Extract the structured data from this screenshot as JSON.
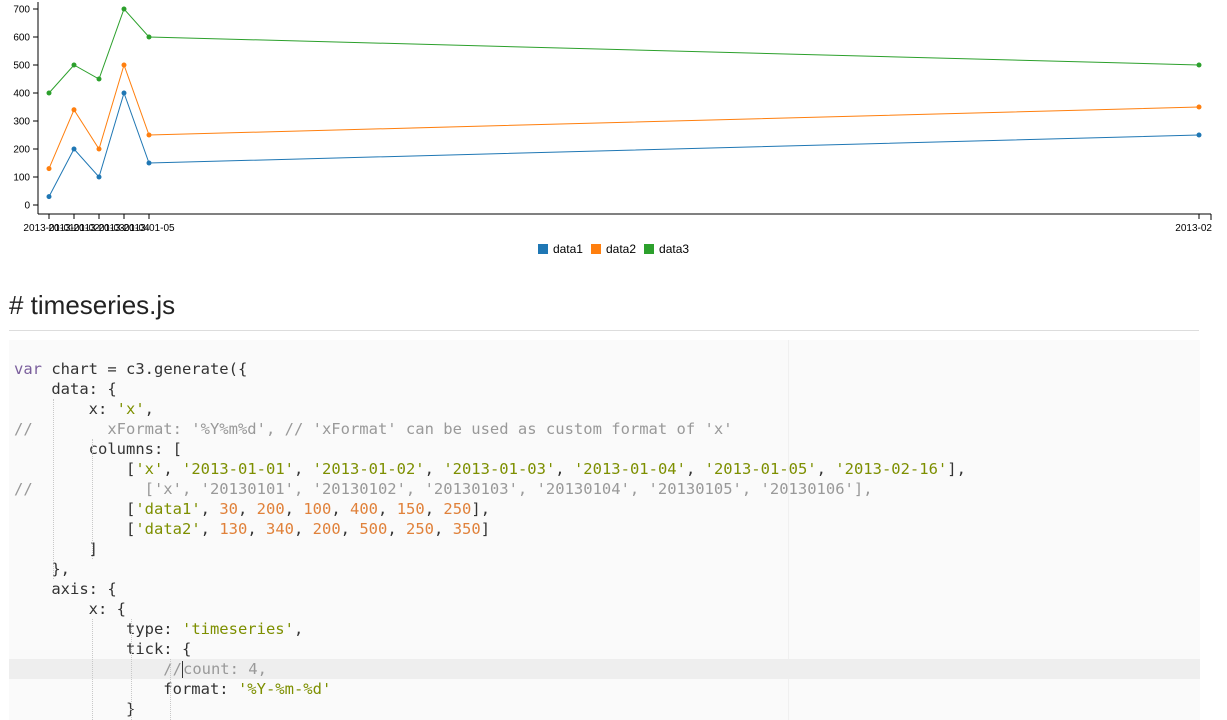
{
  "chart_data": {
    "type": "line",
    "x": [
      "2013-01-01",
      "2013-01-02",
      "2013-01-03",
      "2013-01-04",
      "2013-01-05",
      "2013-02-16"
    ],
    "tick_labels": [
      "2013-01-01",
      "2013-01-02",
      "2013-01-03",
      "2013-01-04",
      "2013-01-05",
      "2013-02"
    ],
    "series": [
      {
        "name": "data1",
        "values": [
          30,
          200,
          100,
          400,
          150,
          250
        ],
        "color": "#1f77b4"
      },
      {
        "name": "data2",
        "values": [
          130,
          340,
          200,
          500,
          250,
          350
        ],
        "color": "#ff7f0e"
      },
      {
        "name": "data3",
        "values": [
          400,
          500,
          450,
          700,
          600,
          500
        ],
        "color": "#2ca02c"
      }
    ],
    "ylim": [
      0,
      700
    ],
    "y_ticks": [
      0,
      100,
      200,
      300,
      400,
      500,
      600,
      700
    ],
    "legend_position": "bottom-center",
    "grid": false
  },
  "heading": "# timeseries.js",
  "code_lines": [
    {
      "tokens": [
        {
          "t": "var",
          "c": "kw"
        },
        {
          "t": " chart = c3.generate({",
          "c": ""
        }
      ]
    },
    {
      "tokens": [
        {
          "t": "    data: {",
          "c": ""
        }
      ]
    },
    {
      "tokens": [
        {
          "t": "        x: ",
          "c": ""
        },
        {
          "t": "'x'",
          "c": "str"
        },
        {
          "t": ",",
          "c": ""
        }
      ]
    },
    {
      "tokens": [
        {
          "t": "//        xFormat: '%Y%m%d', // 'xFormat' can be used as custom format of 'x'",
          "c": "cmt"
        }
      ]
    },
    {
      "tokens": [
        {
          "t": "        columns: [",
          "c": ""
        }
      ]
    },
    {
      "tokens": [
        {
          "t": "            [",
          "c": ""
        },
        {
          "t": "'x'",
          "c": "str"
        },
        {
          "t": ", ",
          "c": ""
        },
        {
          "t": "'2013-01-01'",
          "c": "str"
        },
        {
          "t": ", ",
          "c": ""
        },
        {
          "t": "'2013-01-02'",
          "c": "str"
        },
        {
          "t": ", ",
          "c": ""
        },
        {
          "t": "'2013-01-03'",
          "c": "str"
        },
        {
          "t": ", ",
          "c": ""
        },
        {
          "t": "'2013-01-04'",
          "c": "str"
        },
        {
          "t": ", ",
          "c": ""
        },
        {
          "t": "'2013-01-05'",
          "c": "str"
        },
        {
          "t": ", ",
          "c": ""
        },
        {
          "t": "'2013-02-16'",
          "c": "str"
        },
        {
          "t": "],",
          "c": ""
        }
      ]
    },
    {
      "tokens": [
        {
          "t": "//            ['x', '20130101', '20130102', '20130103', '20130104', '20130105', '20130106'],",
          "c": "cmt"
        }
      ]
    },
    {
      "tokens": [
        {
          "t": "            [",
          "c": ""
        },
        {
          "t": "'data1'",
          "c": "str"
        },
        {
          "t": ", ",
          "c": ""
        },
        {
          "t": "30",
          "c": "num"
        },
        {
          "t": ", ",
          "c": ""
        },
        {
          "t": "200",
          "c": "num"
        },
        {
          "t": ", ",
          "c": ""
        },
        {
          "t": "100",
          "c": "num"
        },
        {
          "t": ", ",
          "c": ""
        },
        {
          "t": "400",
          "c": "num"
        },
        {
          "t": ", ",
          "c": ""
        },
        {
          "t": "150",
          "c": "num"
        },
        {
          "t": ", ",
          "c": ""
        },
        {
          "t": "250",
          "c": "num"
        },
        {
          "t": "],",
          "c": ""
        }
      ]
    },
    {
      "tokens": [
        {
          "t": "            [",
          "c": ""
        },
        {
          "t": "'data2'",
          "c": "str"
        },
        {
          "t": ", ",
          "c": ""
        },
        {
          "t": "130",
          "c": "num"
        },
        {
          "t": ", ",
          "c": ""
        },
        {
          "t": "340",
          "c": "num"
        },
        {
          "t": ", ",
          "c": ""
        },
        {
          "t": "200",
          "c": "num"
        },
        {
          "t": ", ",
          "c": ""
        },
        {
          "t": "500",
          "c": "num"
        },
        {
          "t": ", ",
          "c": ""
        },
        {
          "t": "250",
          "c": "num"
        },
        {
          "t": ", ",
          "c": ""
        },
        {
          "t": "350",
          "c": "num"
        },
        {
          "t": "]",
          "c": ""
        }
      ]
    },
    {
      "tokens": [
        {
          "t": "        ]",
          "c": ""
        }
      ]
    },
    {
      "tokens": [
        {
          "t": "    },",
          "c": ""
        }
      ]
    },
    {
      "tokens": [
        {
          "t": "    axis: {",
          "c": ""
        }
      ]
    },
    {
      "tokens": [
        {
          "t": "        x: {",
          "c": ""
        }
      ]
    },
    {
      "tokens": [
        {
          "t": "            type: ",
          "c": ""
        },
        {
          "t": "'timeseries'",
          "c": "str"
        },
        {
          "t": ",",
          "c": ""
        }
      ]
    },
    {
      "tokens": [
        {
          "t": "            tick: {",
          "c": ""
        }
      ]
    },
    {
      "tokens": [
        {
          "t": "                //",
          "c": "cmt"
        },
        {
          "t": "|caret|",
          "c": "caret"
        },
        {
          "t": "count: 4,",
          "c": "cmt"
        }
      ],
      "highlight": true
    },
    {
      "tokens": [
        {
          "t": "                format: ",
          "c": ""
        },
        {
          "t": "'%Y-%m-%d'",
          "c": "str"
        }
      ]
    },
    {
      "tokens": [
        {
          "t": "            }",
          "c": ""
        }
      ]
    }
  ]
}
